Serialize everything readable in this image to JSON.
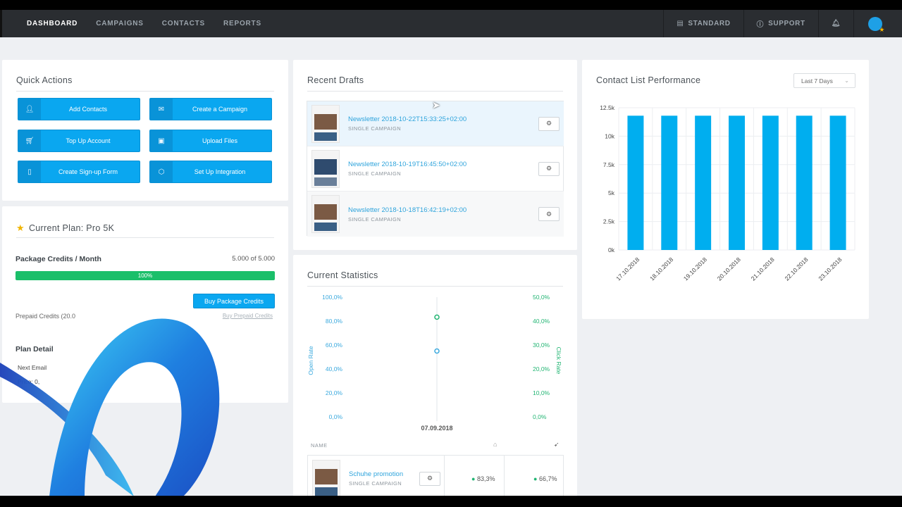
{
  "nav": {
    "items": [
      "DASHBOARD",
      "CAMPAIGNS",
      "CONTACTS",
      "REPORTS"
    ],
    "standard": "STANDARD",
    "support": "SUPPORT"
  },
  "quick_actions": {
    "title": "Quick Actions",
    "buttons": [
      "Add Contacts",
      "Create a Campaign",
      "Top Up Account",
      "Upload Files",
      "Create Sign-up Form",
      "Set Up Integration"
    ]
  },
  "plan": {
    "title": "Current Plan: Pro 5K",
    "credits_label": "Package Credits / Month",
    "credits_value": "5.000 of 5.000",
    "progress_label": "100%",
    "progress_percent": 100,
    "buy_button": "Buy Package Credits",
    "prepaid_label": "Prepaid Credits (20.0",
    "buy_prepaid_link": "Buy Prepaid Credits",
    "details_title": "Plan Detail",
    "next_email": "Next Email",
    "price": "Price: 0,"
  },
  "drafts": {
    "title": "Recent Drafts",
    "items": [
      {
        "name": "Newsletter 2018-10-22T15:33:25+02:00",
        "type": "SINGLE CAMPAIGN"
      },
      {
        "name": "Newsletter 2018-10-19T16:45:50+02:00",
        "type": "SINGLE CAMPAIGN"
      },
      {
        "name": "Newsletter 2018-10-18T16:42:19+02:00",
        "type": "SINGLE CAMPAIGN"
      }
    ]
  },
  "stats": {
    "title": "Current Statistics",
    "left_axis_label": "Open Rate",
    "right_axis_label": "Click Rate",
    "left_ticks": [
      "100,0%",
      "80,0%",
      "60,0%",
      "40,0%",
      "20,0%",
      "0,0%"
    ],
    "right_ticks": [
      "50,0%",
      "40,0%",
      "30,0%",
      "20,0%",
      "10,0%",
      "0,0%"
    ],
    "x_label": "07.09.2018",
    "open_rate_value": 83.3,
    "click_rate_value": 27.5,
    "table_header_name": "NAME",
    "row": {
      "name": "Schuhe promotion",
      "type": "SINGLE CAMPAIGN",
      "open": "83,3%",
      "click": "66,7%"
    }
  },
  "performance": {
    "title": "Contact List Performance",
    "range": "Last 7 Days"
  },
  "chart_data": {
    "type": "bar",
    "title": "Contact List Performance",
    "categories": [
      "17.10.2018",
      "18.10.2018",
      "19.10.2018",
      "20.10.2018",
      "21.10.2018",
      "22.10.2018",
      "23.10.2018"
    ],
    "values": [
      11800,
      11800,
      11800,
      11800,
      11800,
      11800,
      11800
    ],
    "yticks": [
      "12.5k",
      "10k",
      "7.5k",
      "5k",
      "2.5k",
      "0k"
    ],
    "ylim": [
      0,
      12500
    ],
    "bar_color": "#00aeef",
    "grid": true
  }
}
